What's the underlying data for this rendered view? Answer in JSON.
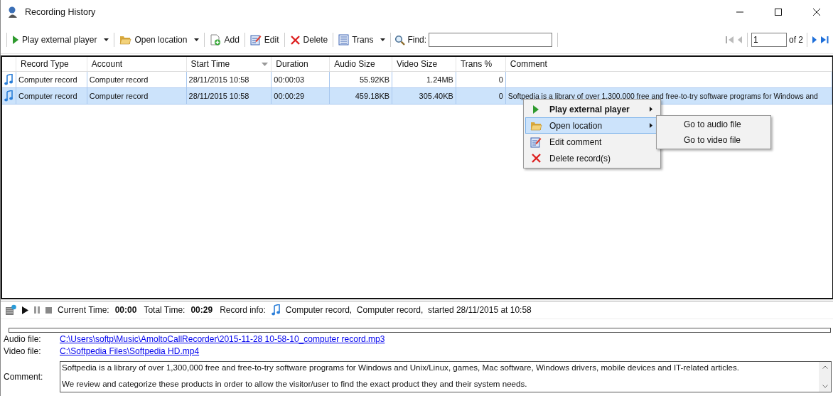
{
  "window": {
    "title": "Recording History"
  },
  "toolbar": {
    "items": [
      {
        "kind": "play",
        "label": "Play external player",
        "dropdown": true
      },
      {
        "kind": "folder",
        "label": "Open location",
        "dropdown": true
      },
      {
        "kind": "add",
        "label": "Add",
        "dropdown": false
      },
      {
        "kind": "edit",
        "label": "Edit",
        "dropdown": false
      },
      {
        "kind": "delete",
        "label": "Delete",
        "dropdown": false
      },
      {
        "kind": "list",
        "label": "Trans",
        "dropdown": true
      }
    ],
    "find_label": "Find:",
    "page": "1",
    "page_count": "of 2"
  },
  "table": {
    "columns": [
      {
        "label": "Record Type",
        "sorted": false
      },
      {
        "label": "Account",
        "sorted": false
      },
      {
        "label": "Start Time",
        "sorted": true
      },
      {
        "label": "Duration",
        "sorted": false
      },
      {
        "label": "Audio Size",
        "sorted": false
      },
      {
        "label": "Video Size",
        "sorted": false
      },
      {
        "label": "Trans %",
        "sorted": false
      },
      {
        "label": "Comment",
        "sorted": false
      }
    ],
    "rows": [
      {
        "selected": false,
        "cells": [
          "Computer record",
          "Computer record",
          "28/11/2015 10:58",
          "00:00:03",
          "55.92KB",
          "1.24MB",
          "0",
          ""
        ]
      },
      {
        "selected": true,
        "cells": [
          "Computer record",
          "Computer record",
          "28/11/2015 10:58",
          "00:00:29",
          "459.18KB",
          "305.40KB",
          "0",
          "Softpedia is a library of over 1,300,000 free and free-to-try software programs for Windows and"
        ]
      }
    ]
  },
  "context_menu": {
    "items": [
      {
        "kind": "play",
        "label": "Play external player",
        "bold": true,
        "submenu": true,
        "selected": false
      },
      {
        "kind": "folder",
        "label": "Open location",
        "bold": false,
        "submenu": true,
        "selected": true
      },
      {
        "kind": "edit",
        "label": "Edit comment",
        "bold": false,
        "submenu": false,
        "selected": false
      },
      {
        "kind": "delete",
        "label": "Delete record(s)",
        "bold": false,
        "submenu": false,
        "selected": false
      }
    ],
    "submenu": [
      "Go to audio file",
      "Go to video file"
    ]
  },
  "player": {
    "current_label": "Current Time:",
    "current": "00:00",
    "total_label": "Total Time:",
    "total": "00:29",
    "info_label": "Record info:",
    "info": "Computer record,  Computer record,  started 28/11/2015 at 10:58"
  },
  "details": {
    "audio_label": "Audio file:",
    "audio_path": "C:\\Users\\softp\\Music\\AmoltoCallRecorder\\2015-11-28 10-58-10_computer record.mp3",
    "video_label": "Video file:",
    "video_path": "C:\\Softpedia Files\\Softpedia HD.mp4",
    "comment_label": "Comment:",
    "comment": [
      "Softpedia is a library of over 1,300,000 free and free-to-try software programs for Windows and Unix/Linux, games, Mac software, Windows drivers, mobile devices and IT-related articles.",
      "We review and categorize these products in order to allow the visitor/user to find the exact product they and their system needs."
    ]
  }
}
